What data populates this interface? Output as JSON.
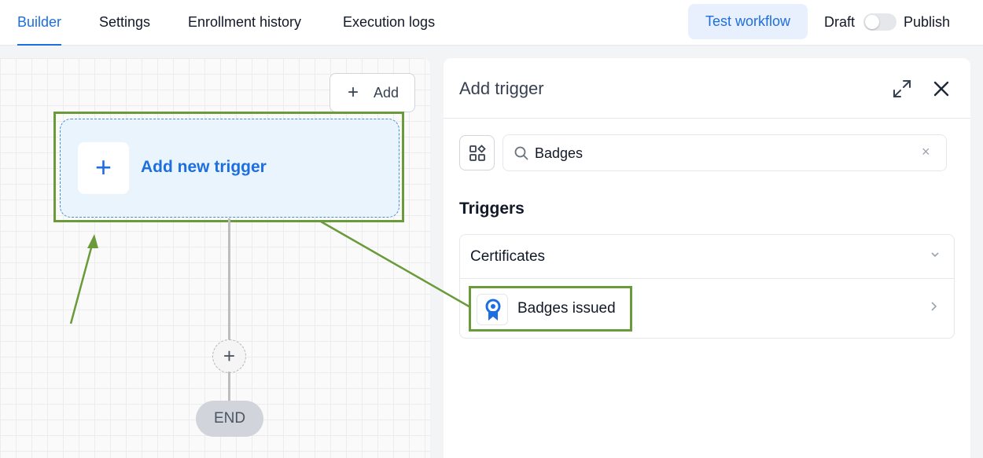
{
  "topbar": {
    "tabs": [
      {
        "label": "Builder",
        "active": true
      },
      {
        "label": "Settings",
        "active": false
      },
      {
        "label": "Enrollment history",
        "active": false
      },
      {
        "label": "Execution logs",
        "active": false
      }
    ],
    "test_button": "Test workflow",
    "draft_label": "Draft",
    "publish_label": "Publish",
    "toggle_on": false
  },
  "canvas": {
    "add_button": "Add",
    "trigger_label": "Add new trigger",
    "end_label": "END"
  },
  "panel": {
    "title": "Add trigger",
    "search": {
      "value": "Badges",
      "placeholder": ""
    },
    "section_title": "Triggers",
    "group_label": "Certificates",
    "item_label": "Badges issued"
  },
  "colors": {
    "accent": "#1d6ee0",
    "highlight": "#6a9a3a"
  }
}
